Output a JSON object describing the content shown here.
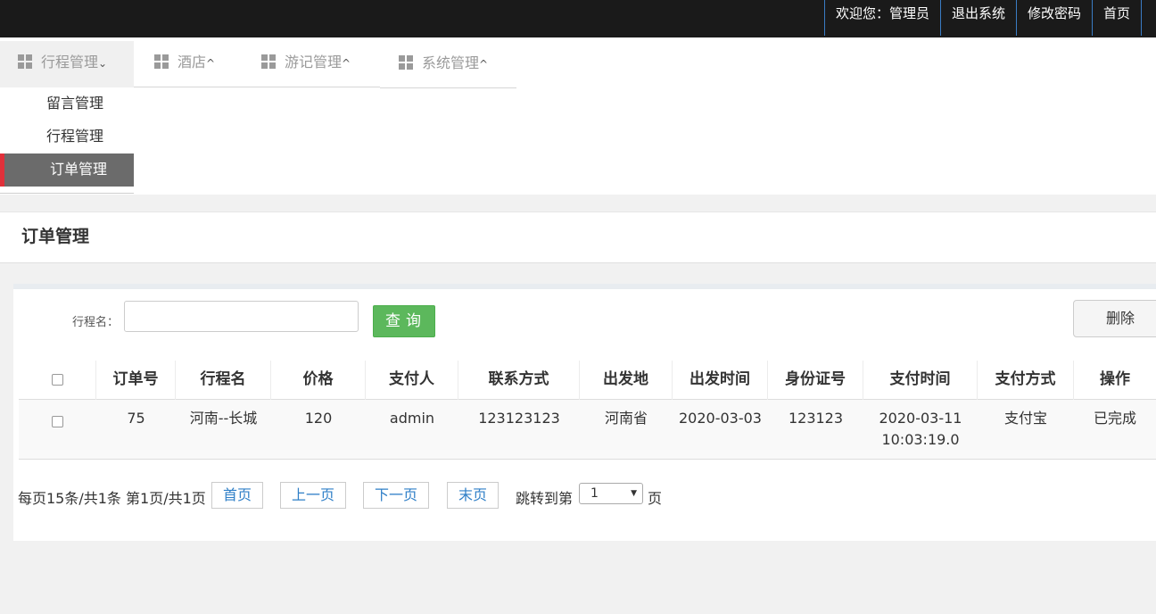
{
  "topbar": {
    "welcome": "欢迎您：管理员",
    "logout": "退出系统",
    "change_password": "修改密码",
    "home": "首页"
  },
  "nav": {
    "items": [
      {
        "label": "行程管理",
        "caret": "⌄"
      },
      {
        "label": "酒店",
        "caret": "^"
      },
      {
        "label": "游记管理",
        "caret": "^"
      },
      {
        "label": "系统管理",
        "caret": "^"
      }
    ],
    "submenu": [
      "留言管理",
      "行程管理",
      "订单管理"
    ]
  },
  "page": {
    "title": "订单管理"
  },
  "search": {
    "label": "行程名：",
    "value": "",
    "query_button": "查询",
    "delete_button": "删除"
  },
  "table": {
    "columns": [
      "订单号",
      "行程名",
      "价格",
      "支付人",
      "联系方式",
      "出发地",
      "出发时间",
      "身份证号",
      "支付时间",
      "支付方式",
      "操作"
    ],
    "rows": [
      {
        "order_no": "75",
        "trip_name": "河南--长城",
        "price": "120",
        "payer": "admin",
        "contact": "123123123",
        "departure_place": "河南省",
        "departure_time": "2020-03-03",
        "id_number": "123123",
        "pay_date": "2020-03-11",
        "pay_clock": "10:03:19.0",
        "pay_method": "支付宝",
        "status": "已完成"
      }
    ]
  },
  "pager": {
    "summary": "每页15条/共1条 第1页/共1页",
    "first": "首页",
    "prev": "上一页",
    "next": "下一页",
    "last": "末页",
    "jump_label": "跳转到第",
    "jump_value": "1",
    "page_unit": "页"
  },
  "colors": {
    "topbar_bg": "#1a1a1a",
    "active_menu_bg": "#6b6b6b",
    "active_menu_marker": "#e0303a",
    "query_button": "#5cb85c",
    "pager_link": "#2f7fc7"
  }
}
